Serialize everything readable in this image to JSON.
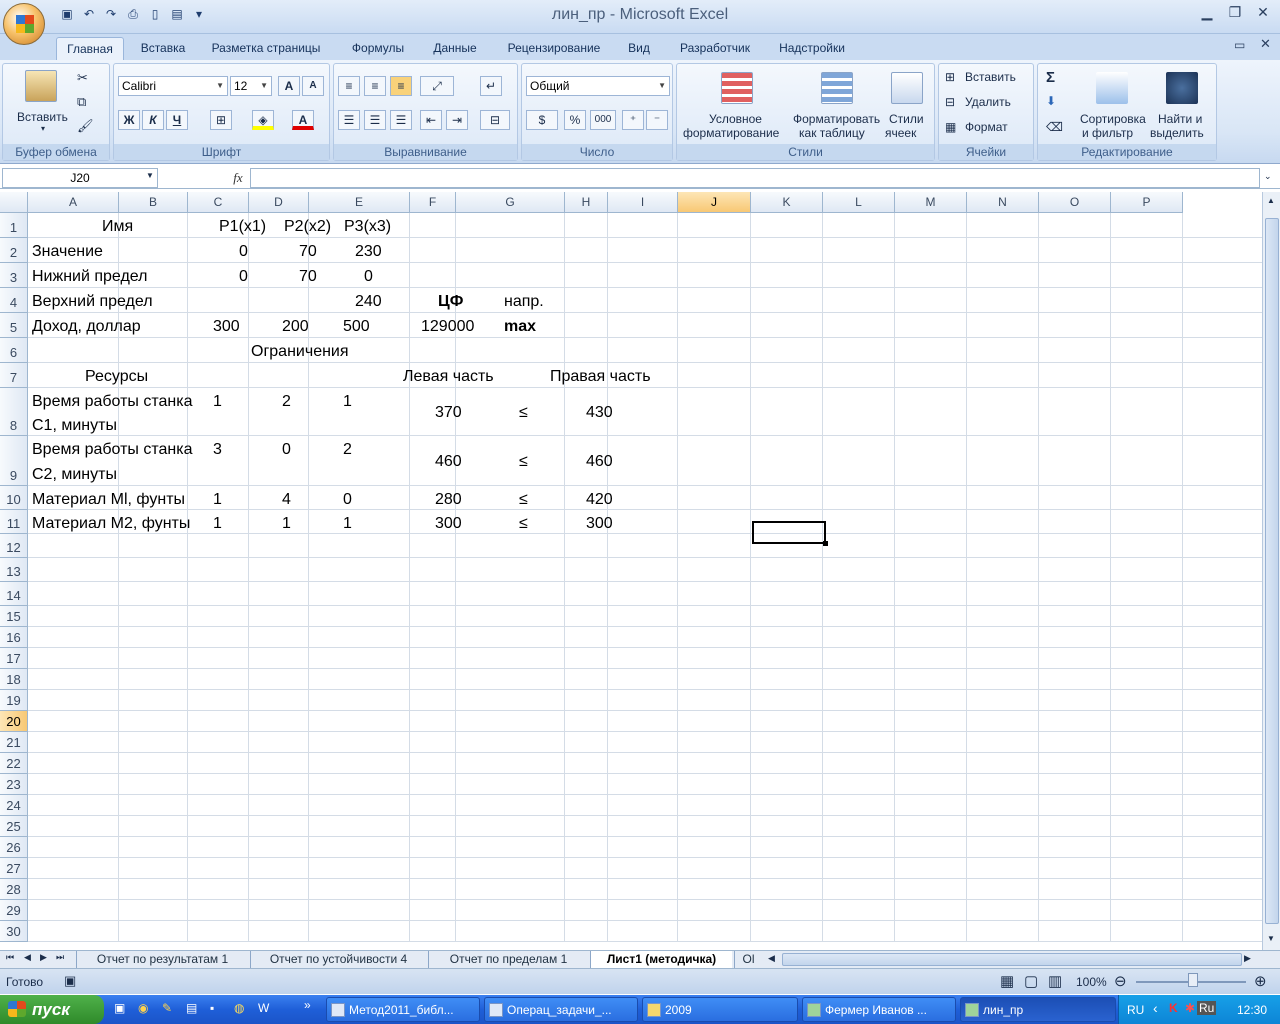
{
  "window": {
    "title": "лин_пр - Microsoft Excel",
    "minimize_glyph": "▁",
    "restore_glyph": "❐",
    "close_glyph": "✕"
  },
  "qat": {
    "icons": [
      "save-icon",
      "undo-icon",
      "redo-icon",
      "print-icon",
      "new-icon",
      "open-icon"
    ]
  },
  "tabs": [
    "Главная",
    "Вставка",
    "Разметка страницы",
    "Формулы",
    "Данные",
    "Рецензирование",
    "Вид",
    "Разработчик",
    "Надстройки"
  ],
  "ribbon": {
    "clipboard": {
      "label": "Буфер обмена",
      "paste": "Вставить"
    },
    "font": {
      "label": "Шрифт",
      "name": "Calibri",
      "size": "12",
      "bold": "Ж",
      "italic": "К",
      "underline": "Ч",
      "grow": "A",
      "shrink": "A",
      "color_letter": "A"
    },
    "alignment": {
      "label": "Выравнивание"
    },
    "number": {
      "label": "Число",
      "format": "Общий",
      "percent": "%",
      "thousands": "000"
    },
    "styles": {
      "label": "Стили",
      "cond1": "Условное",
      "cond2": "форматирование",
      "table1": "Форматировать",
      "table2": "как таблицу",
      "cell1": "Стили",
      "cell2": "ячеек"
    },
    "cells": {
      "label": "Ячейки",
      "insert": "Вставить",
      "delete": "Удалить",
      "format": "Формат"
    },
    "editing": {
      "label": "Редактирование",
      "sum": "Σ",
      "sort1": "Сортировка",
      "sort2": "и фильтр",
      "find1": "Найти и",
      "find2": "выделить"
    }
  },
  "formula_bar": {
    "name_box": "J20",
    "fx": "fx",
    "formula": ""
  },
  "columns": [
    "A",
    "B",
    "C",
    "D",
    "E",
    "F",
    "G",
    "H",
    "I",
    "J",
    "K",
    "L",
    "M",
    "N",
    "O",
    "P"
  ],
  "selected_column": "J",
  "selected_row": "20",
  "rows": [
    "1",
    "2",
    "3",
    "4",
    "5",
    "6",
    "7",
    "8",
    "9",
    "10",
    "11",
    "12",
    "13",
    "14",
    "15",
    "16",
    "17",
    "18",
    "19",
    "20",
    "21",
    "22",
    "23",
    "24",
    "25",
    "26",
    "27",
    "28",
    "29",
    "30"
  ],
  "cells": {
    "a1": "Имя",
    "b1": "P1(x1)",
    "c1": "P2(x2)",
    "d1": "P3(x3)",
    "a2": "Значение",
    "b2": "0",
    "c2": "70",
    "d2": "230",
    "a3": "Нижний предел",
    "b3": "0",
    "c3": "70",
    "d3": "0",
    "a4": "Верхний предел",
    "d4": "240",
    "e4": "ЦФ",
    "f4": "напр.",
    "a5": "Доход, доллар",
    "b5": "300",
    "c5": "200",
    "d5": "500",
    "e5": "129000",
    "f5": "max",
    "b6": "Ограничения",
    "a7": "Ресурсы",
    "e7": "Левая часть",
    "g7": "Правая часть",
    "a8a": "Время работы станка",
    "a8b": "С1, минуты",
    "b8": "1",
    "c8": "2",
    "d8": "1",
    "e8": "370",
    "f8": "≤",
    "g8": "430",
    "a9a": "Время работы станка",
    "a9b": "С2, минуты",
    "b9": "3",
    "c9": "0",
    "d9": "2",
    "e9": "460",
    "f9": "≤",
    "g9": "460",
    "a10": "Материал Ml, фунты",
    "b10": "1",
    "c10": "4",
    "d10": "0",
    "e10": "280",
    "f10": "≤",
    "g10": "420",
    "a11": "Материал M2, фунты",
    "b11": "1",
    "c11": "1",
    "d11": "1",
    "e11": "300",
    "f11": "≤",
    "g11": "300"
  },
  "sheet_tabs": [
    "Отчет по результатам 1",
    "Отчет по устойчивости 4",
    "Отчет по пределам 1",
    "Лист1 (методичка)",
    "Ol"
  ],
  "status": {
    "ready": "Готово",
    "zoom": "100%"
  },
  "taskbar": {
    "start": "пуск",
    "items": [
      "Метод2011_библ...",
      "Операц_задачи_...",
      "2009",
      "Фермер Иванов ...",
      "лин_пр"
    ],
    "lang": "RU",
    "lang2": "Ru",
    "clock": "12:30"
  }
}
